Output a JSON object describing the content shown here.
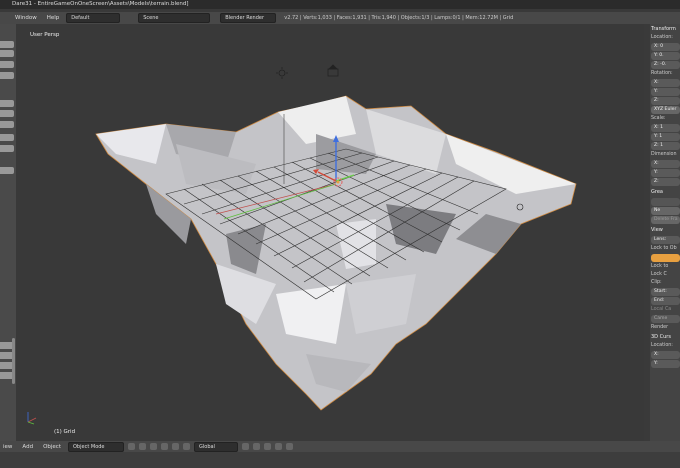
{
  "title_bar": {
    "text": "Dare31 - EntireGameOnOneScreen\\Assets\\Models\\terrain.blend]"
  },
  "menu": {
    "window": "Window",
    "help": "Help"
  },
  "header": {
    "layout_select": "Default",
    "scene_select": "Scene",
    "render_engine": "Blender Render",
    "stats": "v2.72 | Verts:1,033 | Faces:1,931 | Tris:1,940 | Objects:1/3 | Lamps:0/1 | Mem:12.72M | Grid"
  },
  "viewport": {
    "view_label": "User Persp",
    "object_label": "(1) Grid"
  },
  "properties": {
    "transform_header": "Transform",
    "location_label": "Location:",
    "location": {
      "x": "X: 0",
      "y": "Y: 0.",
      "z": "Z: -0."
    },
    "rotation_label": "Rotation:",
    "rotation": {
      "x": "X:",
      "y": "Y:",
      "z": "Z:"
    },
    "rotation_mode": "XYZ Euler",
    "scale_label": "Scale:",
    "scale": {
      "x": "X: 1",
      "y": "Y: 1",
      "z": "Z: 1"
    },
    "dimensions_label": "Dimension",
    "dimensions": {
      "x": "X:",
      "y": "Y:",
      "z": "Z:"
    },
    "grease_header": "Grea",
    "new_button": "Ne",
    "delete_frame": "Delete Fra",
    "view_header": "View",
    "lens": "Lens:",
    "lock_object_label": "Lock to Ob",
    "lock_cursor": "Lock to",
    "lock_camera": "Lock C",
    "clip_label": "Clip:",
    "clip_start": "Start:",
    "clip_end": "End:",
    "local_camera_label": "Local Ca",
    "camera_field": "Came",
    "render_only": "Render",
    "cursor_header": "3D Curs",
    "cursor_location_label": "Location:",
    "cursor": {
      "x": "X:",
      "y": "Y:"
    }
  },
  "bottom_bar": {
    "view": "iew",
    "add": "Add",
    "object": "Object",
    "mode": "Object Mode",
    "orientation": "Global"
  },
  "colors": {
    "accent": "#e8a040",
    "axis_x": "#c0504d",
    "axis_y": "#5fbf3f",
    "axis_z": "#3f6fdf"
  }
}
